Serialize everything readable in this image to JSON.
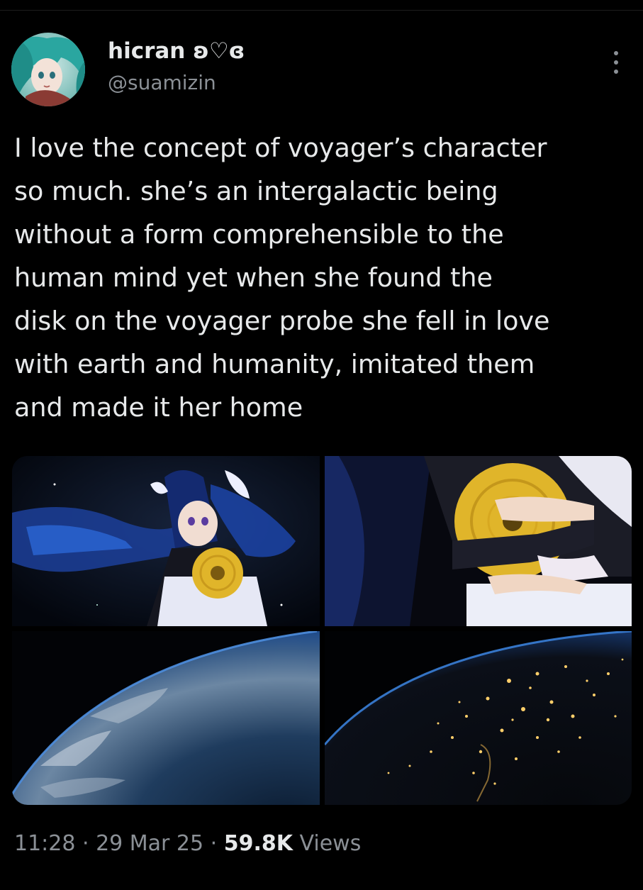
{
  "author": {
    "display_name": "hicran ʚ♡ɞ",
    "handle": "@suamizin"
  },
  "tweet": {
    "lines": [
      "I love the concept of voyager’s character",
      "so much. she’s an intergalactic being",
      "without a form comprehensible to the",
      "human mind yet when she found the",
      "disk on the voyager probe she fell in love",
      "with earth and humanity, imitated them",
      "and made it her home"
    ]
  },
  "media": {
    "count": 4,
    "photos": [
      "anime-girl-holding-golden-record",
      "arms-clutching-golden-record",
      "earth-from-orbit-day",
      "earth-at-night-city-lights"
    ]
  },
  "meta": {
    "time": "11:28",
    "sep1": " · ",
    "date": "29 Mar 25",
    "sep2": " · ",
    "views_count": "59.8K",
    "views_label": " Views"
  },
  "icons": {
    "more": "more-options-icon"
  },
  "colors": {
    "background": "#000000",
    "text_primary": "#e7e9ea",
    "text_secondary": "#8b9096",
    "gold": "#e0b52a"
  }
}
